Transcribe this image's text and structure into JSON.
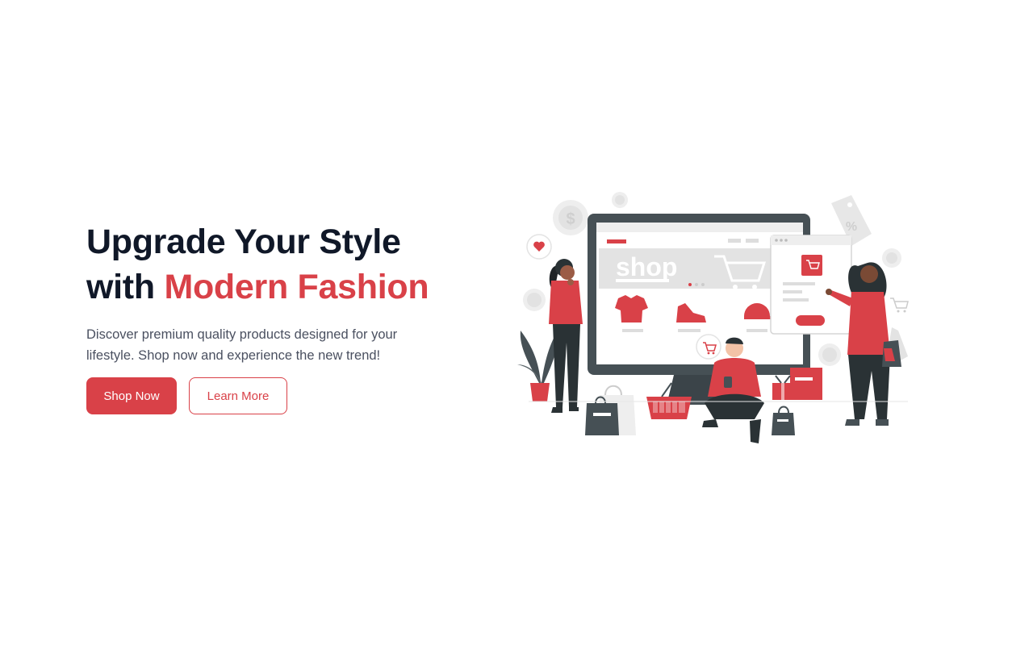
{
  "hero": {
    "title_line1": "Upgrade Your Style",
    "title_with": "with",
    "title_accent": "Modern Fashion",
    "subtitle": "Discover premium quality products designed for your lifestyle. Shop now and experience the new trend!"
  },
  "buttons": {
    "primary_label": "Shop Now",
    "secondary_label": "Learn More"
  },
  "illustration": {
    "screen_word": "shop",
    "discount_tag": "%",
    "currency_symbol": "$"
  },
  "colors": {
    "accent": "#d94148",
    "heading": "#101828",
    "body_text": "#4a5060",
    "monitor": "#465055"
  }
}
